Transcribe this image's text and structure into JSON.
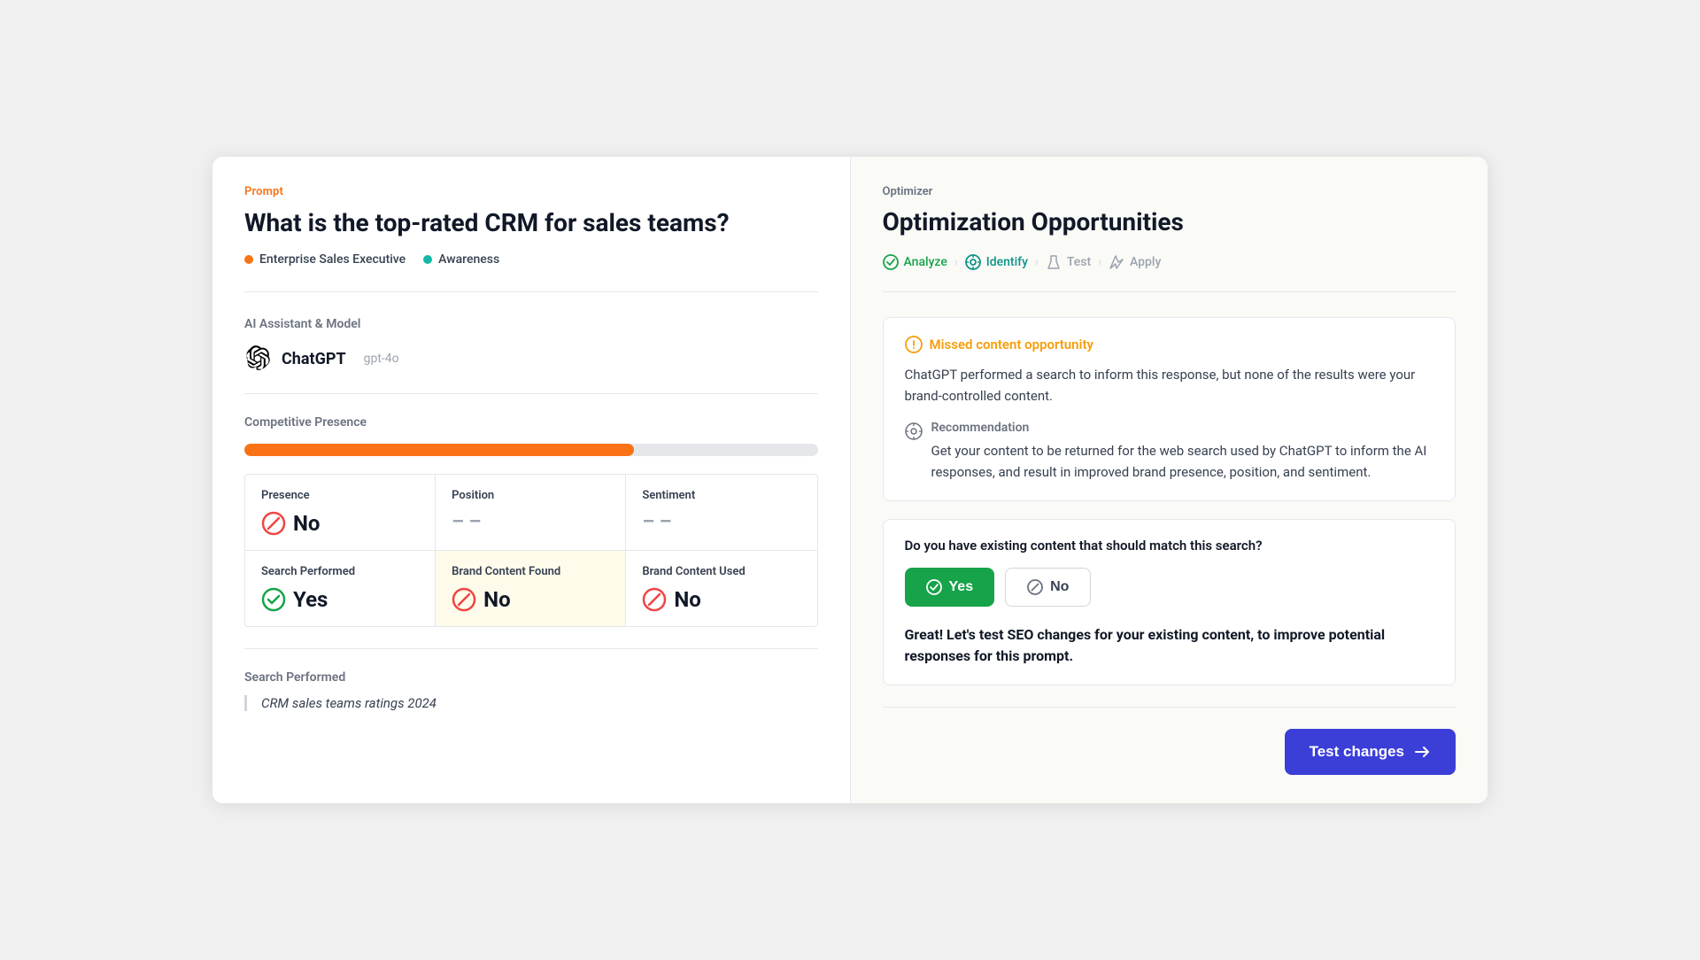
{
  "left": {
    "prompt_label": "Prompt",
    "prompt_title": "What is the top-rated CRM for sales teams?",
    "tags": [
      {
        "label": "Enterprise Sales Executive",
        "color_class": "dot-orange"
      },
      {
        "label": "Awareness",
        "color_class": "dot-teal"
      }
    ],
    "ai_section_title": "AI Assistant & Model",
    "ai_name": "ChatGPT",
    "ai_version": "gpt-4o",
    "presence_section_title": "Competitive Presence",
    "progress_percent": 68,
    "metrics": [
      {
        "label": "Presence",
        "value": "No",
        "type": "no",
        "highlighted": false
      },
      {
        "label": "Position",
        "value": "–––",
        "type": "dash",
        "highlighted": false
      },
      {
        "label": "Sentiment",
        "value": "–––",
        "type": "dash",
        "highlighted": false
      },
      {
        "label": "Search Performed",
        "value": "Yes",
        "type": "yes",
        "highlighted": false
      },
      {
        "label": "Brand Content Found",
        "value": "No",
        "type": "no",
        "highlighted": true
      },
      {
        "label": "Brand Content Used",
        "value": "No",
        "type": "no",
        "highlighted": false
      }
    ],
    "search_label": "Search Performed",
    "search_query": "CRM sales teams ratings 2024"
  },
  "right": {
    "optimizer_label": "Optimizer",
    "optimizer_title": "Optimization Opportunities",
    "steps": [
      {
        "label": "Analyze",
        "state": "done"
      },
      {
        "label": "Identify",
        "state": "active"
      },
      {
        "label": "Test",
        "state": "inactive"
      },
      {
        "label": "Apply",
        "state": "inactive"
      }
    ],
    "opportunity_title": "Missed content opportunity",
    "opportunity_text": "ChatGPT performed a search to inform this response, but none of the results were your brand-controlled content.",
    "recommendation_label": "Recommendation",
    "recommendation_text": "Get your content to be returned for the web search used by ChatGPT to inform the AI responses, and result in improved brand presence, position, and sentiment.",
    "question_text": "Do you have existing content that should match this search?",
    "btn_yes_label": "Yes",
    "btn_no_label": "No",
    "result_text": "Great! Let's test SEO changes for your existing content, to improve potential responses for this prompt.",
    "btn_test_label": "Test changes"
  }
}
